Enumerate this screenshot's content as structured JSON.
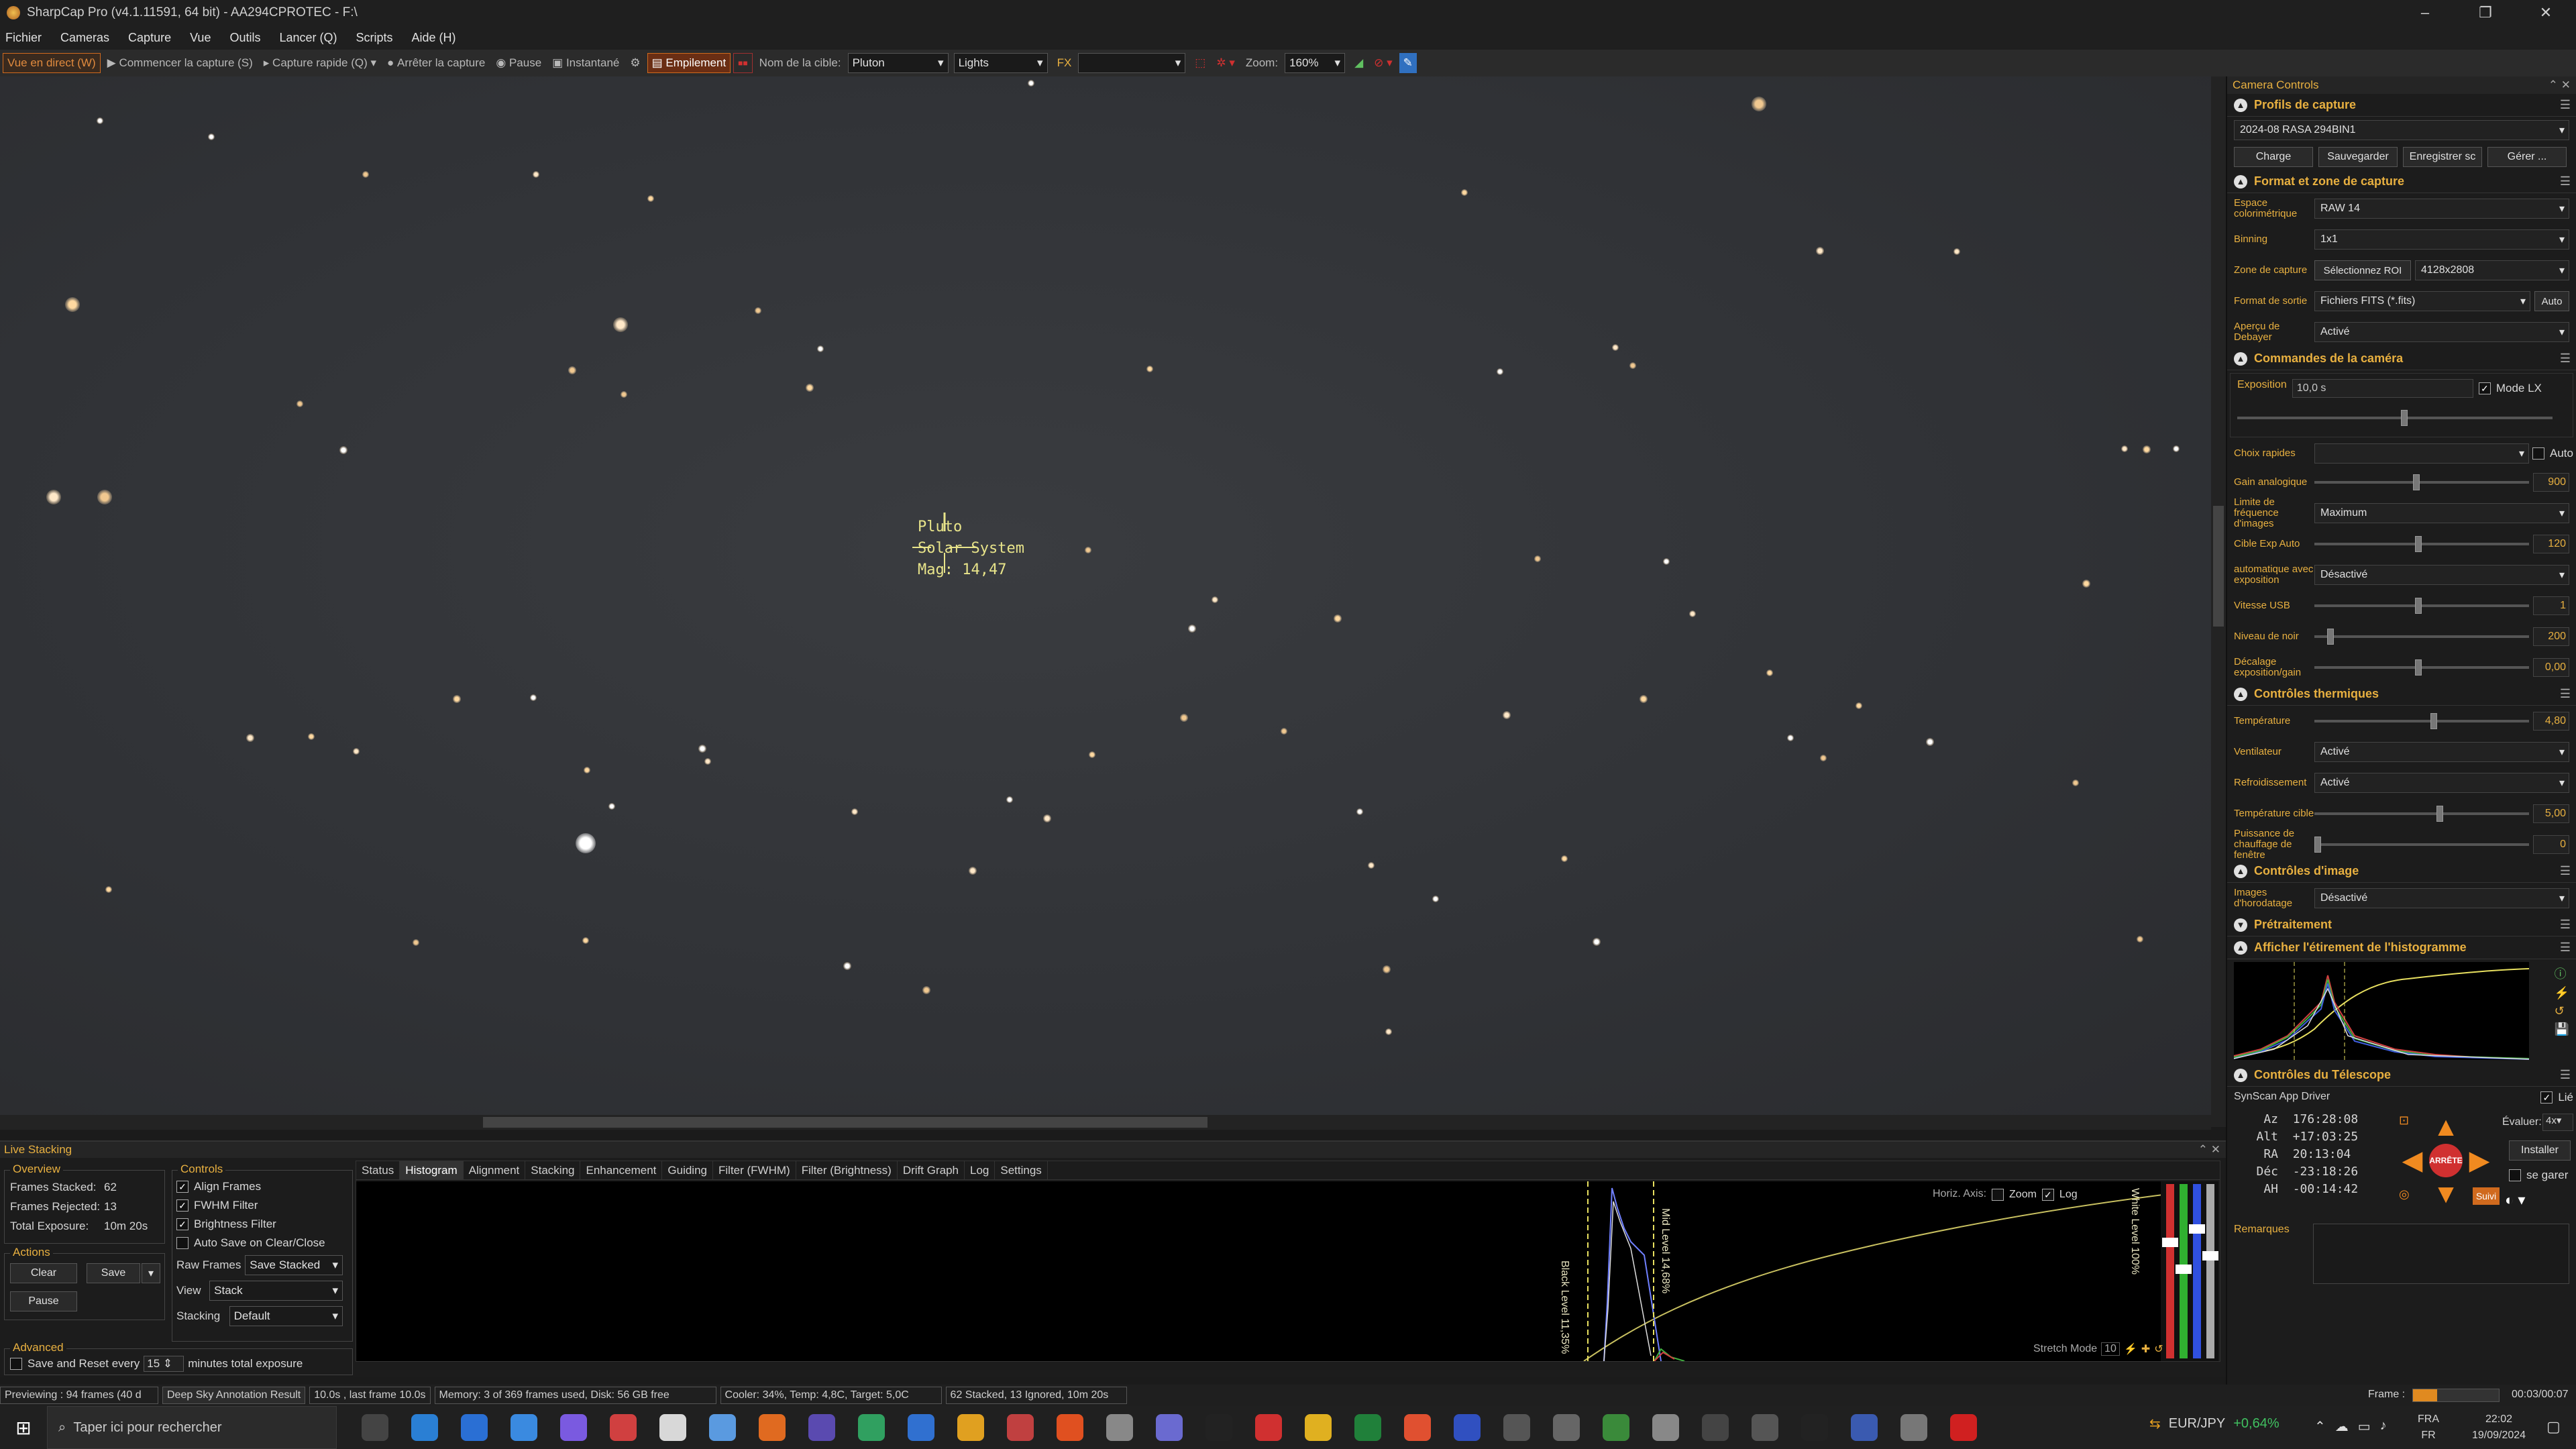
{
  "window": {
    "title": "SharpCap Pro (v4.1.11591, 64 bit) - AA294CPROTEC - F:\\"
  },
  "menu": [
    "Fichier",
    "Cameras",
    "Capture",
    "Vue",
    "Outils",
    "Lancer (Q)",
    "Scripts",
    "Aide (H)"
  ],
  "toolbar": {
    "live_view": "Vue en direct (W)",
    "start_capture": "Commencer la capture (S)",
    "quick_capture": "Capture rapide (Q)",
    "stop_capture": "Arrêter la capture",
    "pause": "Pause",
    "snapshot": "Instantané",
    "stacking": "Empilement",
    "target_label": "Nom de la cible:",
    "target_value": "Pluton",
    "frame_type": "Lights",
    "fx_label": "FX",
    "zoom_label": "Zoom:",
    "zoom_value": "160%"
  },
  "annotation": {
    "name": "Pluto",
    "type": "Solar System",
    "mag": "Mag: 14,47"
  },
  "camera_controls": {
    "header": "Camera Controls",
    "profiles": {
      "title": "Profils de capture",
      "selected": "2024-08 RASA 294BIN1",
      "buttons": [
        "Charge",
        "Sauvegarder",
        "Enregistrer sc",
        "Gérer ..."
      ]
    },
    "format": {
      "title": "Format et zone de capture",
      "rows": [
        {
          "label": "Espace colorimétrique",
          "value": "RAW 14"
        },
        {
          "label": "Binning",
          "value": "1x1"
        },
        {
          "label": "Zone de capture",
          "value": "4128x2808",
          "extra": "Sélectionnez ROI"
        },
        {
          "label": "Format de sortie",
          "value": "Fichiers FITS (*.fits)",
          "extra": "Auto"
        },
        {
          "label": "Aperçu de Debayer",
          "value": "Activé"
        }
      ]
    },
    "camera": {
      "title": "Commandes de la caméra",
      "exposure_label": "Exposition",
      "exposure_value": "10,0 s",
      "mode_lx": "Mode LX",
      "quick_label": "Choix rapides",
      "auto": "Auto",
      "rows": [
        {
          "label": "Gain analogique",
          "value": "900",
          "knob": 0.46
        },
        {
          "label": "Limite de fréquence d'images",
          "value": "Maximum",
          "dd": true
        },
        {
          "label": "Cible Exp Auto",
          "value": "120",
          "knob": 0.47
        },
        {
          "label": "automatique avec exposition",
          "value": "Désactivé",
          "dd": true
        },
        {
          "label": "Vitesse USB",
          "value": "1",
          "knob": 0.47
        },
        {
          "label": "Niveau de noir",
          "value": "200",
          "knob": 0.06
        },
        {
          "label": "Décalage exposition/gain",
          "value": "0,00",
          "knob": 0.47
        }
      ]
    },
    "thermal": {
      "title": "Contrôles thermiques",
      "rows": [
        {
          "label": "Température",
          "value": "4,80",
          "knob": 0.54
        },
        {
          "label": "Ventilateur",
          "value": "Activé",
          "dd": true
        },
        {
          "label": "Refroidissement",
          "value": "Activé",
          "dd": true
        },
        {
          "label": "Température cible",
          "value": "5,00",
          "knob": 0.57
        },
        {
          "label": "Puissance de chauffage de fenêtre",
          "value": "0",
          "knob": 0.0
        }
      ]
    },
    "image": {
      "title": "Contrôles d'image",
      "rows": [
        {
          "label": "Images d'horodatage",
          "value": "Désactivé",
          "dd": true
        }
      ]
    },
    "preprocess": {
      "title": "Prétraitement"
    },
    "histogram": {
      "title": "Afficher l'étirement de l'histogramme"
    },
    "telescope": {
      "title": "Contrôles du Télescope",
      "driver": "SynScan App Driver",
      "linked": "Lié",
      "az": {
        "l": "Az",
        "v": "176:28:08"
      },
      "alt": {
        "l": "Alt",
        "v": "+17:03:25"
      },
      "ra": {
        "l": "RA",
        "v": "20:13:04"
      },
      "dec": {
        "l": "Déc",
        "v": "-23:18:26"
      },
      "ah": {
        "l": "AH",
        "v": "-00:14:42"
      },
      "rate_label": "Évaluer:",
      "rate": "4x",
      "install": "Installer",
      "park": "se garer",
      "stop": "ARRÊTE",
      "track": "Suivi",
      "remarks": "Remarques"
    }
  },
  "live_stacking": {
    "title": "Live Stacking",
    "overview": {
      "title": "Overview",
      "stacked_l": "Frames Stacked:",
      "stacked_v": "62",
      "rejected_l": "Frames Rejected:",
      "rejected_v": "13",
      "exposure_l": "Total Exposure:",
      "exposure_v": "10m 20s"
    },
    "controls": {
      "title": "Controls",
      "align": "Align Frames",
      "fwhm": "FWHM Filter",
      "brightness": "Brightness Filter",
      "autosave": "Auto Save on Clear/Close",
      "raw_l": "Raw Frames",
      "raw_v": "Save Stacked",
      "view_l": "View",
      "view_v": "Stack",
      "stacking_l": "Stacking",
      "stacking_v": "Default"
    },
    "actions": {
      "title": "Actions",
      "clear": "Clear",
      "save": "Save",
      "pause": "Pause"
    },
    "advanced": {
      "title": "Advanced",
      "save_reset": "Save and Reset every",
      "minutes": "15",
      "suffix": "minutes total exposure"
    },
    "tabs": [
      "Status",
      "Histogram",
      "Alignment",
      "Stacking",
      "Enhancement",
      "Guiding",
      "Filter (FWHM)",
      "Filter (Brightness)",
      "Drift Graph",
      "Log",
      "Settings"
    ],
    "hist": {
      "horiz": "Horiz. Axis:",
      "zoom": "Zoom",
      "log": "Log",
      "black": "Black Level 11,35%",
      "mid": "Mid Level 14,68%",
      "white": "White Level 100%",
      "stretch": "Stretch Mode",
      "stretch_v": "10"
    }
  },
  "status": {
    "preview": "Previewing : 94 frames (40 d",
    "dso": "Deep Sky Annotation Result",
    "exposure": "10.0s , last frame 10.0s",
    "memory": "Memory: 3 of 369 frames used, Disk: 56 GB free",
    "cooler": "Cooler: 34%, Temp: 4,8C, Target: 5,0C",
    "stack": "62 Stacked, 13 Ignored, 10m 20s",
    "frame_l": "Frame :",
    "time": "00:03/00:07"
  },
  "taskbar": {
    "search": "Taper ici pour rechercher",
    "ticker": "EUR/JPY",
    "change": "+0,64%",
    "lang": "FRA",
    "lang2": "FR",
    "clock": "22:02",
    "date": "19/09/2024"
  },
  "colors": {
    "accent": "#e8b040",
    "orange": "#d06a1e",
    "red": "#d03030"
  }
}
